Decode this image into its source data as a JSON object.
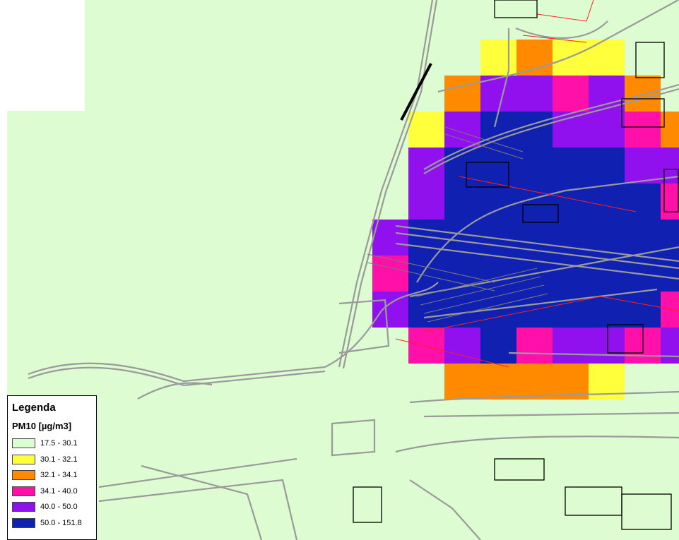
{
  "legend": {
    "title": "Legenda",
    "subtitle": "PM10 [µg/m3]",
    "classes": [
      {
        "range": "17.5 - 30.1",
        "color": "#ddfcd1"
      },
      {
        "range": "30.1 - 32.1",
        "color": "#ffff3c"
      },
      {
        "range": "32.1 - 34.1",
        "color": "#ff8a00"
      },
      {
        "range": "34.1 - 40.0",
        "color": "#ff10a8"
      },
      {
        "range": "40.0 - 50.0",
        "color": "#9010ee"
      },
      {
        "range": "50.0 - 151.8",
        "color": "#1020b0"
      }
    ]
  },
  "colors": {
    "background": "#ddfcd1",
    "roads": "#9a9a9a",
    "red_lines": "#ff2020",
    "buildings": "#000000"
  },
  "grid": {
    "rows": [
      "...............",
      ".....YOYY......",
      "....OPPPPO.....",
      "...YPBBPPPOPP..",
      "...PBBBBBPPOO..",
      "...PBBBBBBPPP..",
      "..PBBBBBBBBBBP.",
      "..PBBBBBBBBBBB.",
      "..PBBBBBBBPPBB.",
      "...PPBPPPPPOY..",
      "....OOOOY......"
    ]
  }
}
